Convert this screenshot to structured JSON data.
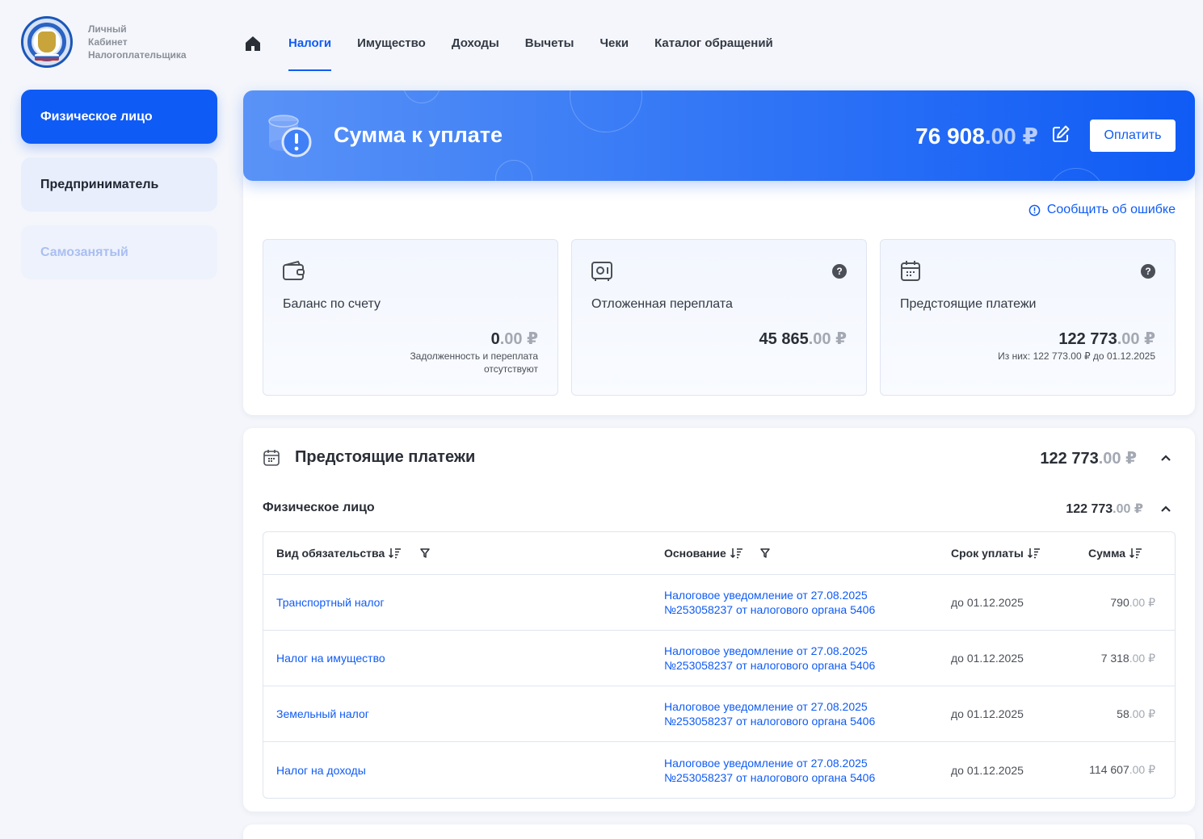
{
  "logo": {
    "line1": "Личный",
    "line2": "Кабинет",
    "line3": "Налогоплательщика"
  },
  "sidebar": {
    "items": [
      {
        "label": "Физическое лицо",
        "state": "active"
      },
      {
        "label": "Предприниматель",
        "state": "normal"
      },
      {
        "label": "Самозанятый",
        "state": "disabled"
      }
    ]
  },
  "nav": {
    "home_icon": "home-icon",
    "tabs": [
      {
        "label": "Налоги",
        "active": true
      },
      {
        "label": "Имущество"
      },
      {
        "label": "Доходы"
      },
      {
        "label": "Вычеты"
      },
      {
        "label": "Чеки"
      },
      {
        "label": "Каталог обращений"
      }
    ]
  },
  "hero": {
    "title": "Сумма к уплате",
    "amount_int": "76 908",
    "amount_frac": ".00 ₽",
    "pay_label": "Оплатить"
  },
  "report_error": "Сообщить об ошибке",
  "cards": [
    {
      "title": "Баланс по счету",
      "amount_int": "0",
      "amount_frac": ".00 ₽",
      "note_line1": "Задолженность и переплата",
      "note_line2": "отсутствуют",
      "icon": "wallet-icon"
    },
    {
      "title": "Отложенная переплата",
      "amount_int": "45 865",
      "amount_frac": ".00 ₽",
      "icon": "safe-icon",
      "help": "?"
    },
    {
      "title": "Предстоящие платежи",
      "amount_int": "122 773",
      "amount_frac": ".00 ₽",
      "note_line1": "Из них: 122 773.00 ₽ до 01.12.2025",
      "icon": "calendar-icon",
      "help": "?"
    }
  ],
  "upcoming": {
    "title": "Предстоящие платежи",
    "total_int": "122 773",
    "total_frac": ".00 ₽",
    "group": {
      "title": "Физическое лицо",
      "total_int": "122 773",
      "total_frac": ".00 ₽"
    },
    "columns": [
      "Вид обязательства",
      "Основание",
      "Срок уплаты",
      "Сумма"
    ],
    "rows": [
      {
        "type": "Транспортный налог",
        "basis1": "Налоговое уведомление от 27.08.2025",
        "basis2": "№253058237 от налогового органа 5406",
        "due": "до 01.12.2025",
        "sum_int": "790",
        "sum_frac": ".00 ₽"
      },
      {
        "type": "Налог на имущество",
        "basis1": "Налоговое уведомление от 27.08.2025",
        "basis2": "№253058237 от налогового органа 5406",
        "due": "до 01.12.2025",
        "sum_int": "7 318",
        "sum_frac": ".00 ₽"
      },
      {
        "type": "Земельный налог",
        "basis1": "Налоговое уведомление от 27.08.2025",
        "basis2": "№253058237 от налогового органа 5406",
        "due": "до 01.12.2025",
        "sum_int": "58",
        "sum_frac": ".00 ₽"
      },
      {
        "type": "Налог на доходы",
        "basis1": "Налоговое уведомление от 27.08.2025",
        "basis2": "№253058237 от налогового органа 5406",
        "due": "до 01.12.2025",
        "sum_int": "114 607",
        "sum_frac": ".00 ₽"
      }
    ]
  },
  "colors": {
    "accent": "#0f5bf5",
    "background": "#f4f6fb",
    "muted": "#a3a8b2"
  }
}
